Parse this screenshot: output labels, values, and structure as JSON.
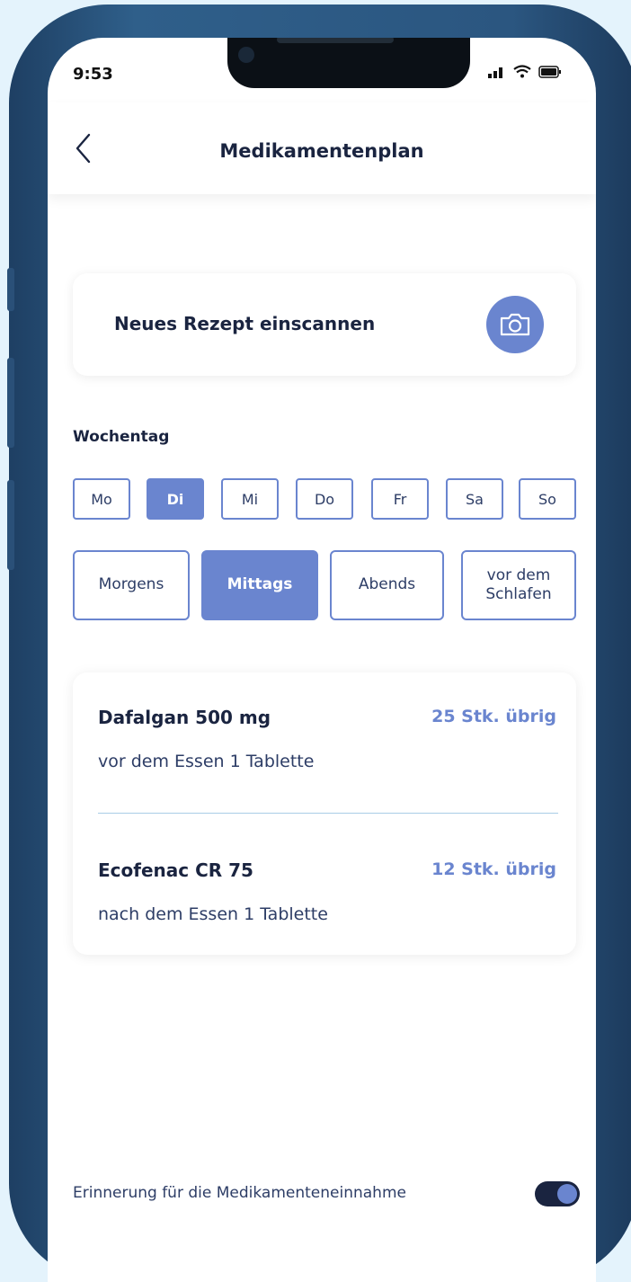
{
  "status_bar": {
    "time": "9:53"
  },
  "header": {
    "title": "Medikamentenplan"
  },
  "scan": {
    "label": "Neues Rezept einscannen"
  },
  "weekday": {
    "label": "Wochentag",
    "days": [
      "Mo",
      "Di",
      "Mi",
      "Do",
      "Fr",
      "Sa",
      "So"
    ],
    "selected": "Di"
  },
  "times": {
    "slots": [
      "Morgens",
      "Mittags",
      "Abends",
      "vor dem Schlafen"
    ],
    "selected": "Mittags"
  },
  "medications": [
    {
      "name": "Dafalgan 500 mg",
      "stock": "25 Stk. übrig",
      "dose": "vor dem Essen 1 Tablette"
    },
    {
      "name": "Ecofenac CR 75",
      "stock": "12 Stk. übrig",
      "dose": "nach dem Essen 1 Tablette"
    }
  ],
  "reminder": {
    "label": "Erinnerung für die Medikamenteneinnahme",
    "enabled": true
  },
  "colors": {
    "accent": "#6a85cf",
    "text_dark": "#1a2440",
    "frame": "#2f5f8a",
    "background": "#e4f3fc"
  },
  "icons": [
    "back-chevron-icon",
    "camera-icon",
    "signal-icon",
    "wifi-icon",
    "battery-icon"
  ]
}
